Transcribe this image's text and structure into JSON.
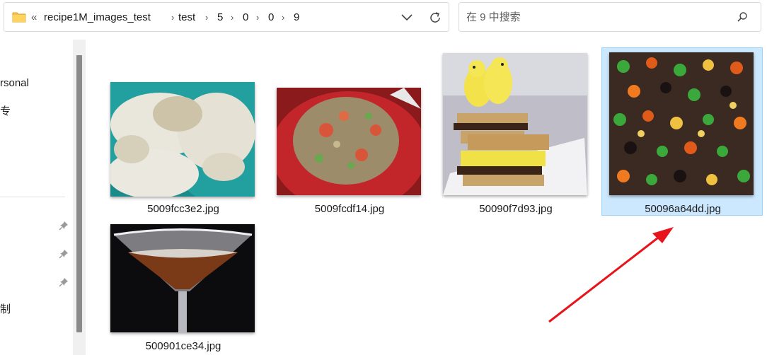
{
  "address_bar": {
    "overflow": "«",
    "breadcrumbs": [
      "recipe1M_images_test",
      "test",
      "5",
      "0",
      "0",
      "9"
    ]
  },
  "search": {
    "placeholder": "在 9 中搜索"
  },
  "nav": {
    "items": [
      "rsonal",
      "专",
      "制"
    ]
  },
  "files": [
    {
      "name": "5009fcc3e2.jpg",
      "selected": false
    },
    {
      "name": "5009fcdf14.jpg",
      "selected": false
    },
    {
      "name": "50090f7d93.jpg",
      "selected": false
    },
    {
      "name": "50096a64dd.jpg",
      "selected": true
    },
    {
      "name": "500901ce34.jpg",
      "selected": false
    }
  ],
  "annotation": {
    "arrow_color": "#e8141c"
  },
  "colors": {
    "selection": "#cce8ff",
    "selection_border": "#99d1ff",
    "folder": "#f4c14b"
  }
}
